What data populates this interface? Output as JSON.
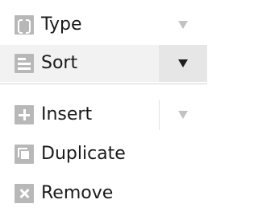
{
  "menu": {
    "items": [
      {
        "label": "Type",
        "icon": "curly-braces-icon",
        "has_submenu": true
      },
      {
        "label": "Sort",
        "icon": "sort-lines-icon",
        "has_submenu": true,
        "highlighted": true
      },
      {
        "label": "Insert",
        "icon": "plus-icon",
        "has_submenu": true
      },
      {
        "label": "Duplicate",
        "icon": "duplicate-icon",
        "has_submenu": false
      },
      {
        "label": "Remove",
        "icon": "remove-x-icon",
        "has_submenu": false
      }
    ]
  },
  "colors": {
    "icon": "#b8b8b8",
    "text": "#1a1a1a",
    "hover_background": "#f2f2f2",
    "active_arrow": "#1e1e1e",
    "inactive_arrow": "#c2c2c2",
    "divider": "#d6d6d6"
  }
}
